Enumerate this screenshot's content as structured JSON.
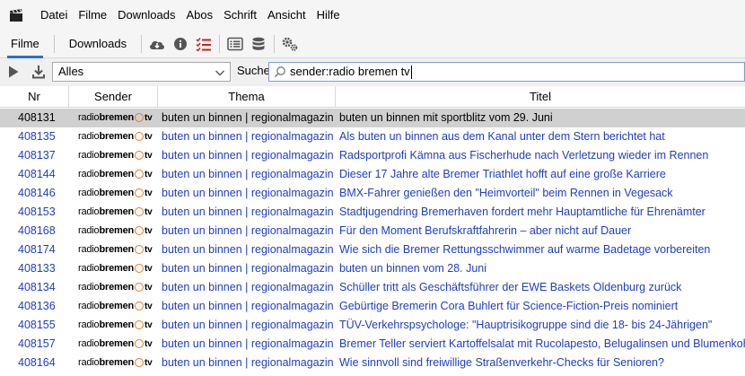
{
  "menubar": {
    "app_icon": "clapperboard-icon",
    "items": [
      "Datei",
      "Filme",
      "Downloads",
      "Abos",
      "Schrift",
      "Ansicht",
      "Hilfe"
    ]
  },
  "toolbar": {
    "tabs": [
      "Filme",
      "Downloads"
    ],
    "active_tab": "Filme",
    "icons": [
      "cloud-download-icon",
      "info-icon",
      "checklist-icon",
      "list-view-icon",
      "database-icon",
      "settings-icon"
    ],
    "accent_color": "#2c6fd2"
  },
  "filterbar": {
    "select_value": "Alles",
    "search_label": "Suche:",
    "search_value": "sender:radio bremen tv"
  },
  "table": {
    "columns": [
      "Nr",
      "Sender",
      "Thema",
      "Titel"
    ],
    "link_color": "#1f3fbf",
    "sender_logo": {
      "part1": "radio",
      "part2": "bremen",
      "part3": "tv"
    },
    "rows": [
      {
        "nr": "408131",
        "thema": "buten un binnen | regionalmagazin",
        "titel": "buten un binnen mit sportblitz vom 29. Juni",
        "selected": true
      },
      {
        "nr": "408135",
        "thema": "buten un binnen | regionalmagazin",
        "titel": "Als buten un binnen aus dem Kanal unter dem Stern berichtet hat"
      },
      {
        "nr": "408137",
        "thema": "buten un binnen | regionalmagazin",
        "titel": "Radsportprofi Kämna aus Fischerhude nach Verletzung wieder im Rennen"
      },
      {
        "nr": "408144",
        "thema": "buten un binnen | regionalmagazin",
        "titel": "Dieser 17 Jahre alte Bremer Triathlet hofft auf eine große Karriere"
      },
      {
        "nr": "408146",
        "thema": "buten un binnen | regionalmagazin",
        "titel": "BMX-Fahrer genießen den \"Heimvorteil\" beim Rennen in Vegesack"
      },
      {
        "nr": "408153",
        "thema": "buten un binnen | regionalmagazin",
        "titel": "Stadtjugendring Bremerhaven fordert mehr Hauptamtliche für Ehrenämter"
      },
      {
        "nr": "408168",
        "thema": "buten un binnen | regionalmagazin",
        "titel": "Für den Moment Berufskraftfahrerin – aber nicht auf Dauer"
      },
      {
        "nr": "408174",
        "thema": "buten un binnen | regionalmagazin",
        "titel": "Wie sich die Bremer Rettungsschwimmer auf warme Badetage vorbereiten"
      },
      {
        "nr": "408133",
        "thema": "buten un binnen | regionalmagazin",
        "titel": "buten un binnen vom 28. Juni"
      },
      {
        "nr": "408134",
        "thema": "buten un binnen | regionalmagazin",
        "titel": "Schüller tritt als Geschäftsführer der EWE Baskets Oldenburg zurück"
      },
      {
        "nr": "408136",
        "thema": "buten un binnen | regionalmagazin",
        "titel": "Gebürtige Bremerin Cora Buhlert für Science-Fiction-Preis nominiert"
      },
      {
        "nr": "408155",
        "thema": "buten un binnen | regionalmagazin",
        "titel": "TÜV-Verkehrspsychologe: \"Hauptrisikogruppe sind die 18- bis 24-Jährigen\""
      },
      {
        "nr": "408157",
        "thema": "buten un binnen | regionalmagazin",
        "titel": "Bremer Teller serviert Kartoffelsalat mit Rucolapesto, Belugalinsen und Blumenkohl"
      },
      {
        "nr": "408164",
        "thema": "buten un binnen | regionalmagazin",
        "titel": "Wie sinnvoll sind freiwillige Straßenverkehr-Checks für Senioren?"
      }
    ]
  }
}
